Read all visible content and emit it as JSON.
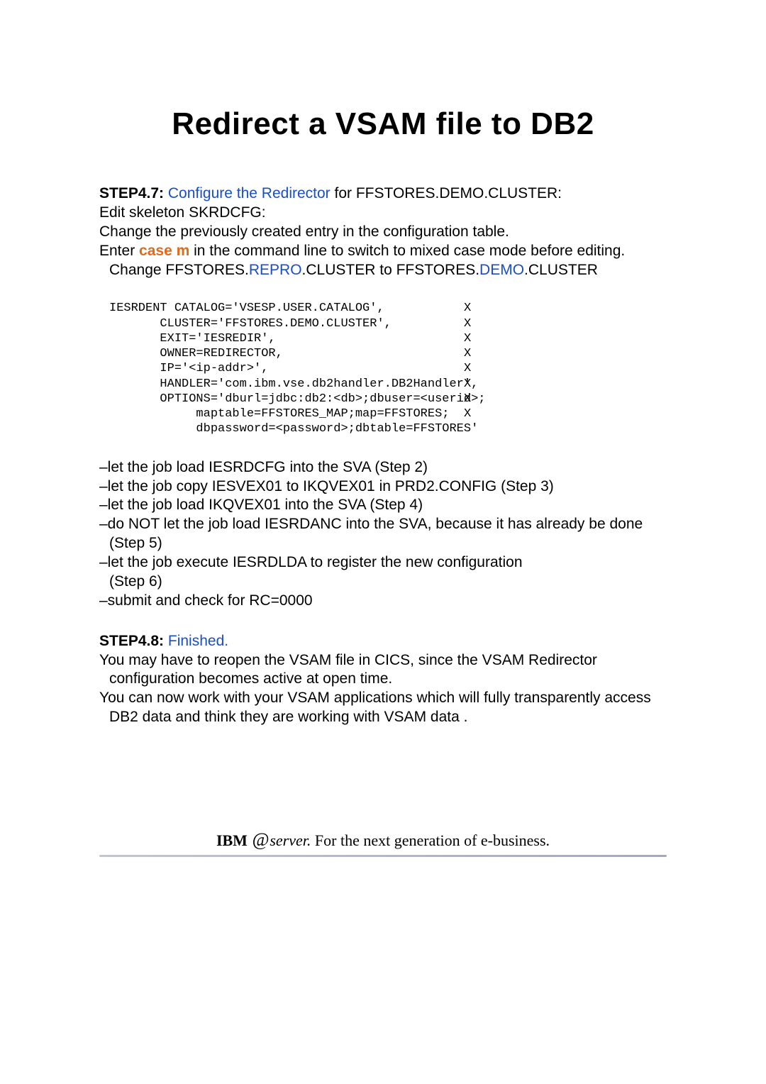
{
  "title": "Redirect a VSAM file to DB2",
  "step47": {
    "label": "STEP4.7:",
    "linkText": " Configure the Redirector ",
    "postLink": "for FFSTORES.DEMO.CLUSTER:",
    "editLine": "Edit skeleton SKRDCFG:",
    "changeLine": "Change the previously created entry in the configuration table.",
    "enterPrefix": "Enter ",
    "caseM": "case m",
    "enterSuffix": " in the command line to switch to mixed case mode before editing. Change FFSTORES.",
    "repro": "REPRO",
    "clusterTo": ".CLUSTER to FFSTORES.",
    "demo": "DEMO",
    "clusterEnd": ".CLUSTER"
  },
  "code": {
    "lines": [
      {
        "left": "IESRDENT CATALOG='VSESP.USER.CATALOG',",
        "x": "X"
      },
      {
        "left": "       CLUSTER='FFSTORES.DEMO.CLUSTER',",
        "x": "X"
      },
      {
        "left": "       EXIT='IESREDIR',",
        "x": "X"
      },
      {
        "left": "       OWNER=REDIRECTOR,",
        "x": "X"
      },
      {
        "left": "       IP='<ip-addr>',",
        "x": "X"
      },
      {
        "left": "       HANDLER='com.ibm.vse.db2handler.DB2Handler',",
        "x": "X"
      },
      {
        "left": "       OPTIONS='dburl=jdbc:db2:<db>;dbuser=<userid>;",
        "x": "X"
      },
      {
        "left": "            maptable=FFSTORES_MAP;map=FFSTORES;",
        "x": "X"
      },
      {
        "left": "            dbpassword=<password>;dbtable=FFSTORES'",
        "x": ""
      }
    ]
  },
  "bullets": [
    "–let the job load IESRDCFG into the SVA (Step 2)",
    "–let the job copy IESVEX01 to IKQVEX01 in PRD2.CONFIG (Step 3)",
    "–let the job load IKQVEX01 into the SVA (Step 4)",
    "–do NOT let the job load IESRDANC into the SVA, because it has already be done (Step 5)",
    "–let the job execute IESRDLDA to register the new configuration",
    "(Step 6)",
    "–submit and check for RC=0000"
  ],
  "step48": {
    "label": "STEP4.8:",
    "linkText": " Finished.",
    "para1": "You may have to reopen the VSAM file in CICS, since the VSAM Redirector configuration becomes active at open time.",
    "para2": "You can now work with your VSAM applications which will fully transparently access DB2 data and think they are working with VSAM data ."
  },
  "footer": {
    "ibm": "IBM ",
    "at": "@",
    "server": "server.",
    "tagline": "  For the next generation of e-business."
  }
}
